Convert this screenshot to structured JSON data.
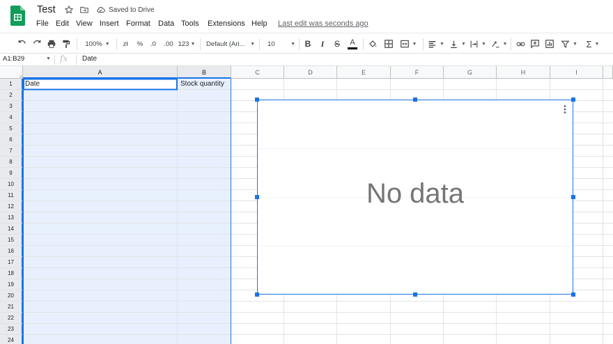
{
  "document": {
    "title": "Test",
    "saved_status": "Saved to Drive",
    "last_edit": "Last edit was seconds ago"
  },
  "menu": [
    "File",
    "Edit",
    "View",
    "Insert",
    "Format",
    "Data",
    "Tools",
    "Extensions",
    "Help"
  ],
  "toolbar": {
    "zoom": "100%",
    "currency": "zł",
    "percent": "%",
    "decrease_decimal": ".0",
    "increase_decimal": ".00",
    "more_formats": "123",
    "font": "Default (Ari...",
    "font_size": "10",
    "bold": "B",
    "italic": "I",
    "strikethrough": "S",
    "text_color": "A"
  },
  "formula_bar": {
    "name_box": "A1:B29",
    "fx": "fx",
    "value": "Date"
  },
  "columns": [
    "A",
    "B",
    "C",
    "D",
    "E",
    "F",
    "G",
    "H",
    "I"
  ],
  "rows": [
    "1",
    "2",
    "3",
    "4",
    "5",
    "6",
    "7",
    "8",
    "9",
    "10",
    "11",
    "12",
    "13",
    "14",
    "15",
    "16",
    "17",
    "18",
    "19",
    "20",
    "21",
    "22",
    "23",
    "24"
  ],
  "cells": {
    "A1": "Date",
    "B1": "Stock quantity"
  },
  "chart": {
    "message": "No data"
  },
  "colors": {
    "accent": "#1a73e8",
    "selection_fill": "#e8f0fe",
    "sheets_green": "#0f9d58"
  }
}
